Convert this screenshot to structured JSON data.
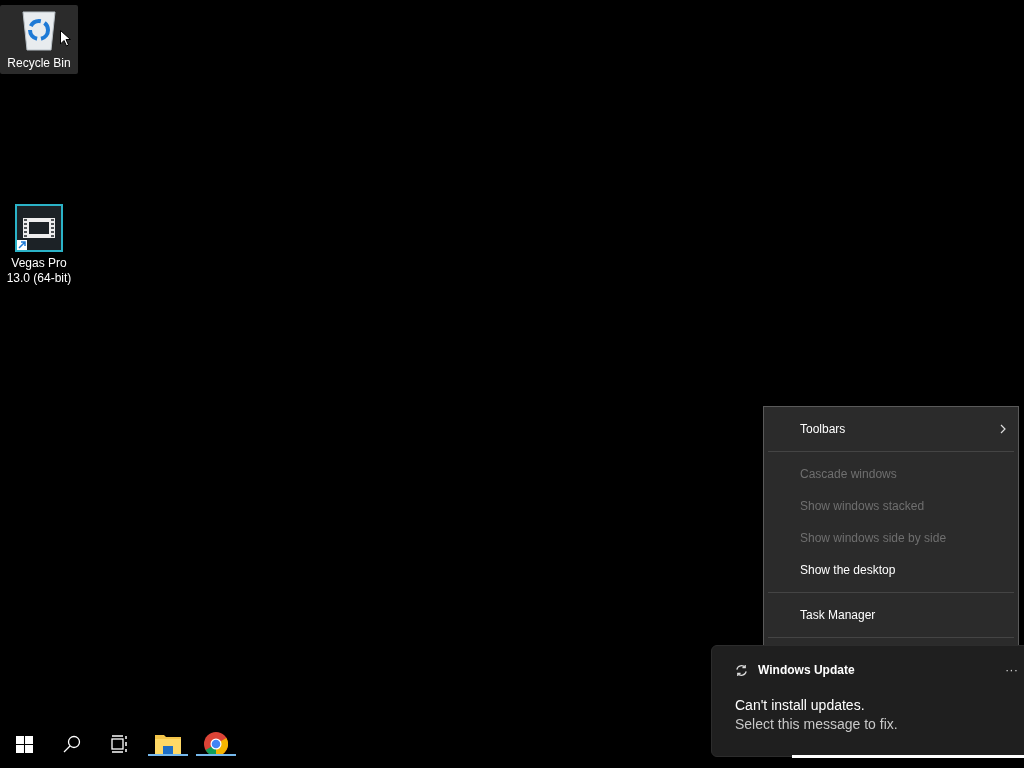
{
  "desktop_icons": [
    {
      "kind": "recycle-bin",
      "label": "Recycle Bin",
      "selected": true
    },
    {
      "kind": "video-editor",
      "label": "Vegas Pro 13.0 (64-bit)",
      "selected": false
    }
  ],
  "context_menu": {
    "items": [
      {
        "kind": "item",
        "label": "Toolbars",
        "disabled": false,
        "submenu": true
      },
      {
        "kind": "separator"
      },
      {
        "kind": "item",
        "label": "Cascade windows",
        "disabled": true,
        "submenu": false
      },
      {
        "kind": "item",
        "label": "Show windows stacked",
        "disabled": true,
        "submenu": false
      },
      {
        "kind": "item",
        "label": "Show windows side by side",
        "disabled": true,
        "submenu": false
      },
      {
        "kind": "item",
        "label": "Show the desktop",
        "disabled": false,
        "submenu": false
      },
      {
        "kind": "separator"
      },
      {
        "kind": "item",
        "label": "Task Manager",
        "disabled": false,
        "submenu": false
      },
      {
        "kind": "separator"
      }
    ]
  },
  "notification": {
    "app": "Windows Update",
    "title": "Can't install updates.",
    "message": "Select this message to fix.",
    "more": "···"
  },
  "taskbar": [
    {
      "kind": "start",
      "running": false
    },
    {
      "kind": "search",
      "running": false
    },
    {
      "kind": "task-view",
      "running": false
    },
    {
      "kind": "file-explorer",
      "running": true
    },
    {
      "kind": "browser",
      "running": true
    }
  ]
}
